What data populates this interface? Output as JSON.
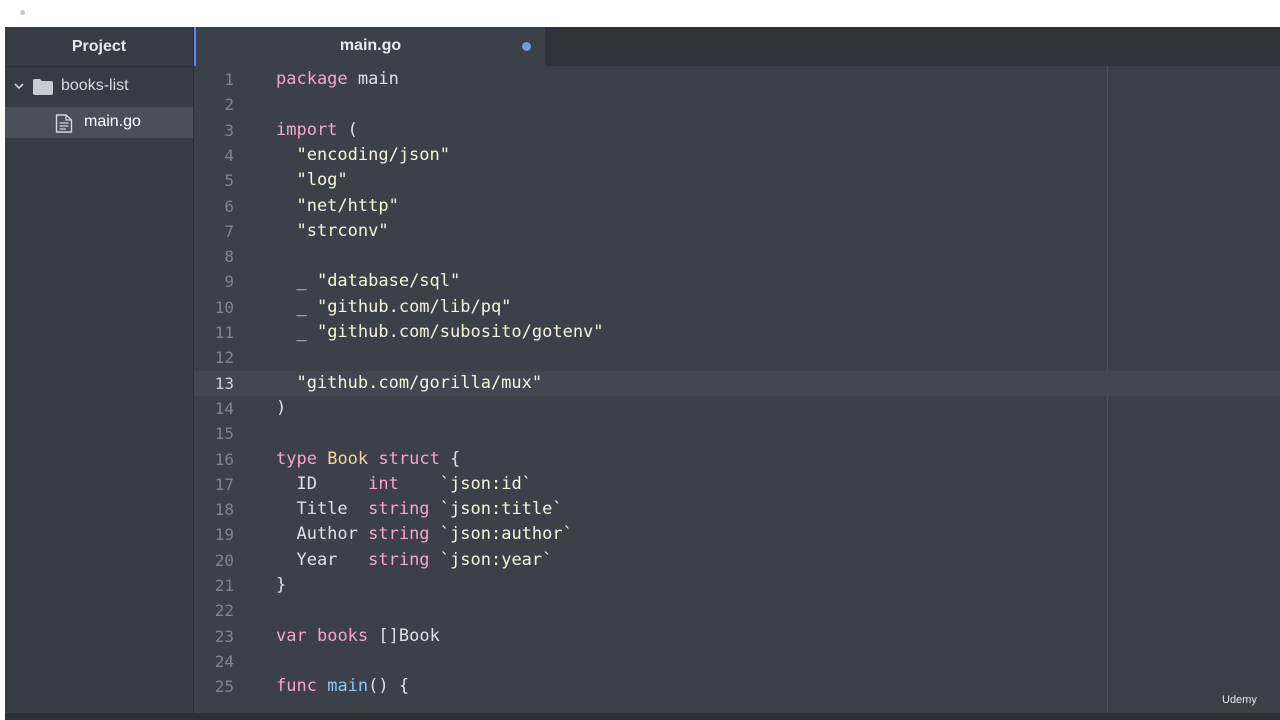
{
  "sidebar": {
    "title": "Project",
    "folder": "books-list",
    "file": "main.go"
  },
  "tab": {
    "title": "main.go"
  },
  "editor": {
    "current_line": 13,
    "lines": [
      {
        "n": "1",
        "tokens": [
          {
            "t": "package",
            "c": "kw"
          },
          {
            "t": " main",
            "c": ""
          }
        ]
      },
      {
        "n": "2",
        "tokens": []
      },
      {
        "n": "3",
        "tokens": [
          {
            "t": "import",
            "c": "kw"
          },
          {
            "t": " (",
            "c": ""
          }
        ]
      },
      {
        "n": "4",
        "tokens": [
          {
            "t": "  \"encoding/json\"",
            "c": "str"
          }
        ]
      },
      {
        "n": "5",
        "tokens": [
          {
            "t": "  \"log\"",
            "c": "str"
          }
        ]
      },
      {
        "n": "6",
        "tokens": [
          {
            "t": "  \"net/http\"",
            "c": "str"
          }
        ]
      },
      {
        "n": "7",
        "tokens": [
          {
            "t": "  \"strconv\"",
            "c": "str"
          }
        ]
      },
      {
        "n": "8",
        "tokens": []
      },
      {
        "n": "9",
        "tokens": [
          {
            "t": "  _ ",
            "c": ""
          },
          {
            "t": "\"database/sql\"",
            "c": "str"
          }
        ]
      },
      {
        "n": "10",
        "tokens": [
          {
            "t": "  _ ",
            "c": ""
          },
          {
            "t": "\"github.com/lib/pq\"",
            "c": "str"
          }
        ]
      },
      {
        "n": "11",
        "tokens": [
          {
            "t": "  _ ",
            "c": ""
          },
          {
            "t": "\"github.com/subosito/gotenv\"",
            "c": "str"
          }
        ]
      },
      {
        "n": "12",
        "tokens": []
      },
      {
        "n": "13",
        "tokens": [
          {
            "t": "  \"github.com/gorilla/mux\"",
            "c": "str"
          }
        ]
      },
      {
        "n": "14",
        "tokens": [
          {
            "t": ")",
            "c": ""
          }
        ]
      },
      {
        "n": "15",
        "tokens": []
      },
      {
        "n": "16",
        "tokens": [
          {
            "t": "type",
            "c": "kw"
          },
          {
            "t": " ",
            "c": ""
          },
          {
            "t": "Book",
            "c": "ty"
          },
          {
            "t": " ",
            "c": ""
          },
          {
            "t": "struct",
            "c": "kw"
          },
          {
            "t": " {",
            "c": ""
          }
        ]
      },
      {
        "n": "17",
        "tokens": [
          {
            "t": "  ID     ",
            "c": ""
          },
          {
            "t": "int",
            "c": "kw"
          },
          {
            "t": "    ",
            "c": ""
          },
          {
            "t": "`json:id`",
            "c": "str"
          }
        ]
      },
      {
        "n": "18",
        "tokens": [
          {
            "t": "  Title  ",
            "c": ""
          },
          {
            "t": "string",
            "c": "kw"
          },
          {
            "t": " ",
            "c": ""
          },
          {
            "t": "`json:title`",
            "c": "str"
          }
        ]
      },
      {
        "n": "19",
        "tokens": [
          {
            "t": "  Author ",
            "c": ""
          },
          {
            "t": "string",
            "c": "kw"
          },
          {
            "t": " ",
            "c": ""
          },
          {
            "t": "`json:author`",
            "c": "str"
          }
        ]
      },
      {
        "n": "20",
        "tokens": [
          {
            "t": "  Year   ",
            "c": ""
          },
          {
            "t": "string",
            "c": "kw"
          },
          {
            "t": " ",
            "c": ""
          },
          {
            "t": "`json:year`",
            "c": "str"
          }
        ]
      },
      {
        "n": "21",
        "tokens": [
          {
            "t": "}",
            "c": ""
          }
        ]
      },
      {
        "n": "22",
        "tokens": []
      },
      {
        "n": "23",
        "tokens": [
          {
            "t": "var",
            "c": "kw"
          },
          {
            "t": " ",
            "c": ""
          },
          {
            "t": "books",
            "c": "kw"
          },
          {
            "t": " []Book",
            "c": ""
          }
        ]
      },
      {
        "n": "24",
        "tokens": []
      },
      {
        "n": "25",
        "tokens": [
          {
            "t": "func",
            "c": "kw"
          },
          {
            "t": " ",
            "c": ""
          },
          {
            "t": "main",
            "c": "fn"
          },
          {
            "t": "() {",
            "c": ""
          }
        ]
      }
    ]
  },
  "watermark": "Udemy"
}
